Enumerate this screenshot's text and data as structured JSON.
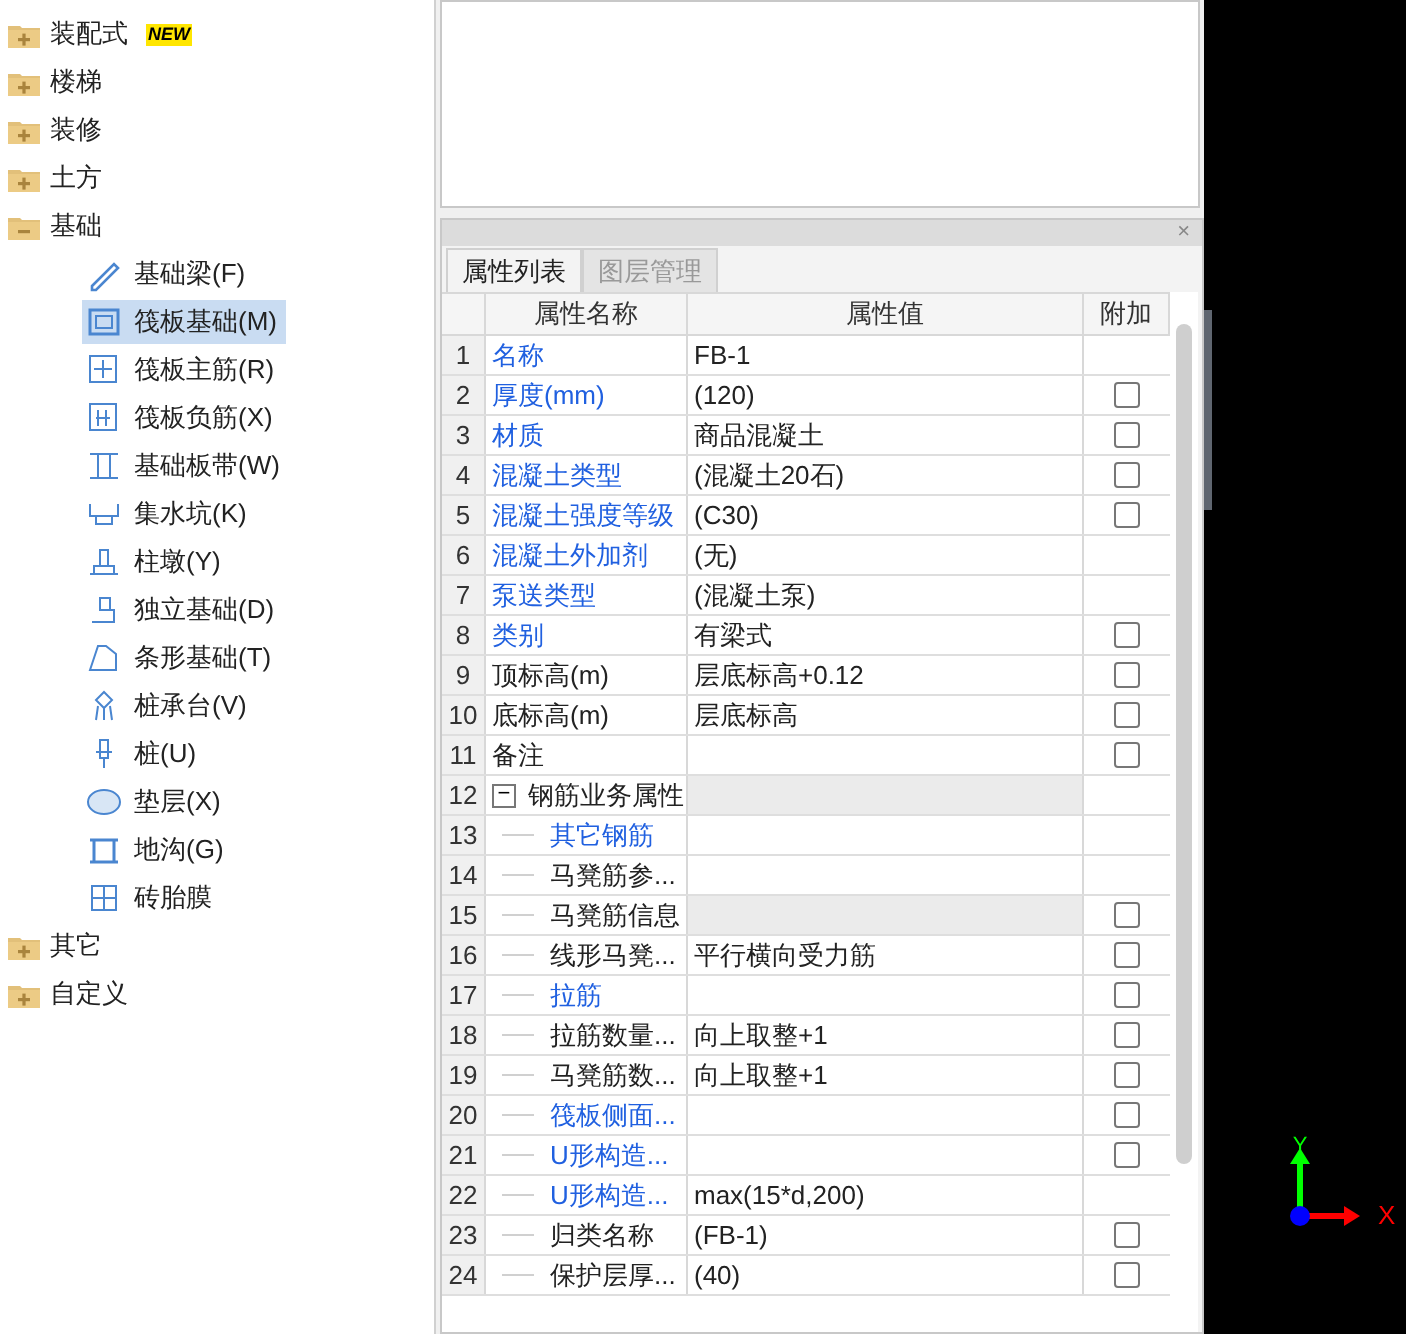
{
  "tree": [
    {
      "label": "装配式",
      "badge": "NEW",
      "expanded": false
    },
    {
      "label": "楼梯",
      "expanded": false
    },
    {
      "label": "装修",
      "expanded": false
    },
    {
      "label": "土方",
      "expanded": false
    },
    {
      "label": "基础",
      "expanded": true,
      "children": [
        {
          "label": "基础梁(F)",
          "selected": false
        },
        {
          "label": "筏板基础(M)",
          "selected": true
        },
        {
          "label": "筏板主筋(R)",
          "selected": false
        },
        {
          "label": "筏板负筋(X)",
          "selected": false
        },
        {
          "label": "基础板带(W)",
          "selected": false
        },
        {
          "label": "集水坑(K)",
          "selected": false
        },
        {
          "label": "柱墩(Y)",
          "selected": false
        },
        {
          "label": "独立基础(D)",
          "selected": false
        },
        {
          "label": "条形基础(T)",
          "selected": false
        },
        {
          "label": "桩承台(V)",
          "selected": false
        },
        {
          "label": "桩(U)",
          "selected": false
        },
        {
          "label": "垫层(X)",
          "selected": false
        },
        {
          "label": "地沟(G)",
          "selected": false
        },
        {
          "label": "砖胎膜",
          "selected": false
        }
      ]
    },
    {
      "label": "其它",
      "expanded": false
    },
    {
      "label": "自定义",
      "expanded": false
    }
  ],
  "panel": {
    "close": "×",
    "tabs": [
      {
        "label": "属性列表",
        "selected": true
      },
      {
        "label": "图层管理",
        "selected": false
      }
    ],
    "columns": [
      "属性名称",
      "属性值",
      "附加"
    ],
    "rows": [
      {
        "number": "1",
        "name": "名称",
        "value": "FB-1",
        "link": true
      },
      {
        "number": "2",
        "name": "厚度(mm)",
        "value": "(120)",
        "link": true,
        "checked": false
      },
      {
        "number": "3",
        "name": "材质",
        "value": "商品混凝土",
        "link": true,
        "checked": false
      },
      {
        "number": "4",
        "name": "混凝土类型",
        "value": "(混凝土20石)",
        "link": true,
        "checked": false
      },
      {
        "number": "5",
        "name": "混凝土强度等级",
        "value": "(C30)",
        "link": true,
        "checked": false
      },
      {
        "number": "6",
        "name": "混凝土外加剂",
        "value": "(无)",
        "link": true
      },
      {
        "number": "7",
        "name": "泵送类型",
        "value": "(混凝土泵)",
        "link": true
      },
      {
        "number": "8",
        "name": "类别",
        "value": "有梁式",
        "link": true,
        "checked": false
      },
      {
        "number": "9",
        "name": "顶标高(m)",
        "value": "层底标高+0.12",
        "link": false,
        "checked": false
      },
      {
        "number": "10",
        "name": "底标高(m)",
        "value": "层底标高",
        "link": false,
        "checked": false
      },
      {
        "number": "11",
        "name": "备注",
        "link": false,
        "checked": false
      },
      {
        "number": "12",
        "name": "钢筋业务属性",
        "link": false,
        "readonly": true,
        "expanded": true,
        "toggle": "−",
        "children": [
          {
            "number": "13",
            "name": "其它钢筋",
            "link": true
          },
          {
            "number": "14",
            "name": "马凳筋参...",
            "link": false
          },
          {
            "number": "15",
            "name": "马凳筋信息",
            "link": false,
            "readonly": true,
            "checked": false
          },
          {
            "number": "16",
            "name": "线形马凳...",
            "value": "平行横向受力筋",
            "link": false,
            "checked": false
          },
          {
            "number": "17",
            "name": "拉筋",
            "link": true,
            "checked": false
          },
          {
            "number": "18",
            "name": "拉筋数量...",
            "value": "向上取整+1",
            "link": false,
            "checked": false
          },
          {
            "number": "19",
            "name": "马凳筋数...",
            "value": "向上取整+1",
            "link": false,
            "checked": false
          },
          {
            "number": "20",
            "name": "筏板侧面...",
            "link": true,
            "checked": false
          },
          {
            "number": "21",
            "name": "U形构造...",
            "link": true,
            "checked": false
          },
          {
            "number": "22",
            "name": "U形构造...",
            "value": "max(15*d,200)",
            "link": true
          },
          {
            "number": "23",
            "name": "归类名称",
            "value": "(FB-1)",
            "link": false,
            "checked": false
          },
          {
            "number": "24",
            "name": "保护层厚...",
            "value": "(40)",
            "link": false,
            "checked": false
          }
        ]
      }
    ]
  },
  "viewport": {
    "axes": [
      "Y",
      "X"
    ]
  }
}
